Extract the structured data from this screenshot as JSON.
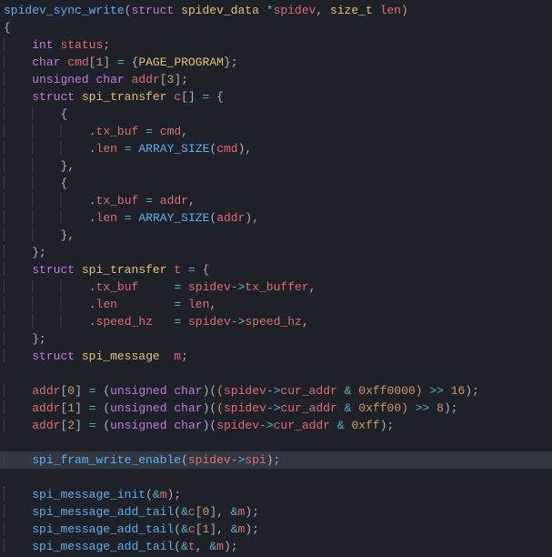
{
  "code": {
    "fn_decl": "spidev_sync_write",
    "struct_kw": "struct",
    "param_type": "spidev_data",
    "param_star": "*",
    "param_name": "spidev",
    "size_t": "size_t",
    "len_param": "len",
    "int_kw": "int",
    "status": "status",
    "char_kw": "char",
    "cmd": "cmd",
    "one": "1",
    "page_program": "PAGE_PROGRAM",
    "unsigned_kw": "unsigned",
    "addr": "addr",
    "three": "3",
    "spi_transfer": "spi_transfer",
    "c_arr": "c",
    "tx_buf": "tx_buf",
    "len_field": "len",
    "array_size": "ARRAY_SIZE",
    "t_struct": "t",
    "spidev": "spidev",
    "tx_buffer": "tx_buffer",
    "len_var": "len",
    "speed_hz": "speed_hz",
    "spi_message": "spi_message",
    "m_var": "m",
    "zero": "0",
    "two": "2",
    "cur_addr": "cur_addr",
    "mask_ff0000": "0xff0000",
    "mask_ff00": "0xff00",
    "mask_ff": "0xff",
    "shift16": "16",
    "shift8": "8",
    "spi_fram_write_enable": "spi_fram_write_enable",
    "spi_field": "spi",
    "spi_message_init": "spi_message_init",
    "spi_message_add_tail": "spi_message_add_tail"
  }
}
